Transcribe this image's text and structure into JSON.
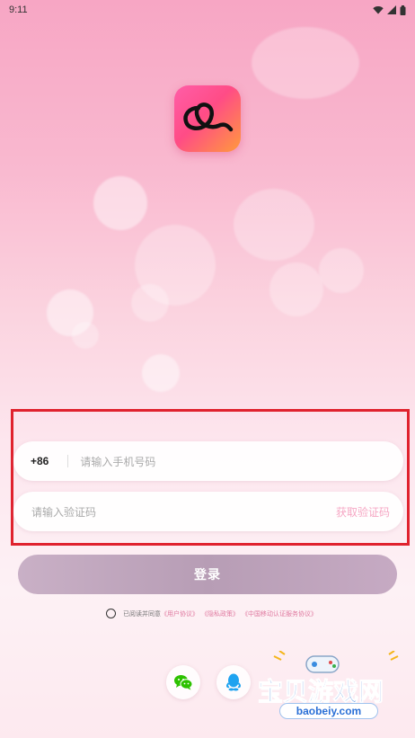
{
  "status_bar": {
    "time": "9:11"
  },
  "login_form": {
    "country_code": "+86",
    "phone_placeholder": "请输入手机号码",
    "code_placeholder": "请输入验证码",
    "get_code_label": "获取验证码",
    "login_label": "登录"
  },
  "agreement": {
    "prefix": "已阅读并同意",
    "user_agreement": "《用户协议》",
    "privacy_policy": "《隐私政策》",
    "cmcc_terms": "《中国移动认证服务协议》"
  },
  "social": {
    "wechat_icon": "wechat-icon",
    "qq_icon": "qq-icon"
  },
  "watermark": {
    "title": "宝贝游戏网",
    "url": "baobeiy.com"
  },
  "colors": {
    "accent_pink": "#ff4c86",
    "login_button": "#b79db5",
    "highlight_border": "#e0222e",
    "link": "#e07aa0"
  }
}
